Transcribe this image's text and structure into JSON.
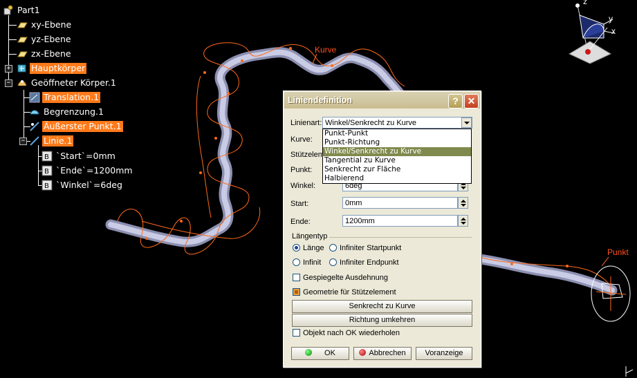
{
  "tree": {
    "root": "Part1",
    "items": [
      {
        "label": "xy-Ebene"
      },
      {
        "label": "yz-Ebene"
      },
      {
        "label": "zx-Ebene"
      },
      {
        "label": "Hauptkörper"
      },
      {
        "label": "Geöffneter Körper.1"
      },
      {
        "label": "Translation.1"
      },
      {
        "label": "Begrenzung.1"
      },
      {
        "label": "Äußerster Punkt.1"
      },
      {
        "label": "Linie.1"
      },
      {
        "label": "`Start`=0mm"
      },
      {
        "label": "`Ende`=1200mm"
      },
      {
        "label": "`Winkel`=6deg"
      }
    ]
  },
  "viewport": {
    "curve_label": "Kurve",
    "point_label": "Punkt",
    "compass": {
      "z": "z",
      "y": "y",
      "x": "x"
    },
    "colors": {
      "tube": "#b9bcd8",
      "geometry": "#ff6a1a",
      "highlight": "#ff7a1a"
    }
  },
  "dialog": {
    "title": "Liniendefinition",
    "help": "?",
    "close": "✕",
    "line_type_label": "Linienart:",
    "line_type_value": "Winkel/Senkrecht zu Kurve",
    "dropdown_options": [
      "Punkt-Punkt",
      "Punkt-Richtung",
      "Winkel/Senkrecht zu Kurve",
      "Tangential zu Kurve",
      "Senkrecht zur Fläche",
      "Halbierend"
    ],
    "selected_index": 2,
    "curve_label": "Kurve:",
    "support_label": "Stützelem",
    "point_label": "Punkt:",
    "angle_label": "Winkel:",
    "angle_value": "6deg",
    "start_label": "Start:",
    "start_value": "0mm",
    "end_label": "Ende:",
    "end_value": "1200mm",
    "length_type_title": "Längentyp",
    "radio_length": "Länge",
    "radio_inf_start": "Infiniter Startpunkt",
    "radio_infinite": "Infinit",
    "radio_inf_end": "Infiniter Endpunkt",
    "mirrored": "Gespiegelte Ausdehnung",
    "geometry_support": "Geometrie für Stützelement",
    "btn_normal_curve": "Senkrecht zu Kurve",
    "btn_reverse": "Richtung umkehren",
    "repeat_object": "Objekt nach OK wiederholen",
    "ok": "OK",
    "cancel": "Abbrechen",
    "preview": "Voranzeige"
  }
}
